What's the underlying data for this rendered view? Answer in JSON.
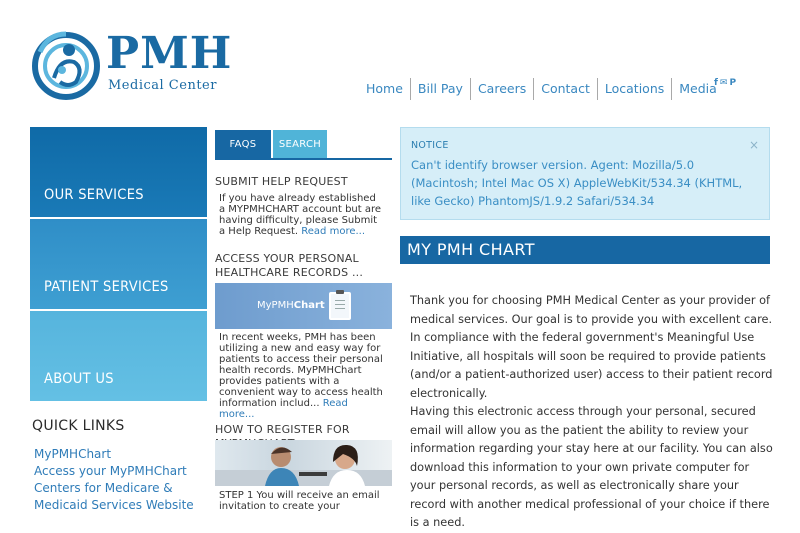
{
  "logo": {
    "name": "PMH",
    "subtitle": "Medical Center"
  },
  "nav": [
    "Home",
    "Bill Pay",
    "Careers",
    "Contact",
    "Locations",
    "Media"
  ],
  "social": {
    "facebook": "f",
    "email": "✉",
    "pinterest": "P"
  },
  "left_tiles": [
    "OUR SERVICES",
    "PATIENT SERVICES",
    "ABOUT US"
  ],
  "quick_links": {
    "title": "QUICK LINKS",
    "items": [
      "MyPMHChart",
      "Access your MyPMHChart",
      "Centers for Medicare &",
      "Medicaid Services Website"
    ]
  },
  "mid": {
    "tabs": [
      "FAQS",
      "SEARCH"
    ],
    "sections": [
      {
        "title": "SUBMIT HELP REQUEST",
        "body": "If you have already established a MYPMHCHART account but are having difficulty, please Submit a Help Request.",
        "more": "Read more..."
      },
      {
        "title": "ACCESS YOUR PERSONAL HEALTHCARE RECORDS ...",
        "body": "In recent weeks, PMH has been utilizing a new and easy way for patients to access their personal health records. MyPMHChart provides patients with a convenient way to access health information includ...",
        "more": "Read more..."
      },
      {
        "title": "HOW TO REGISTER FOR MYPMHCHART",
        "body": "STEP 1 You will receive an email invitation to create your",
        "more": ""
      }
    ],
    "banner": {
      "prefix": "MyPMH",
      "suffix": "Chart"
    }
  },
  "notice": {
    "title": "NOTICE",
    "close": "×",
    "message": "Can't identify browser version. Agent: Mozilla/5.0 (Macintosh; Intel Mac OS X) AppleWebKit/534.34 (KHTML, like Gecko) PhantomJS/1.9.2 Safari/534.34"
  },
  "main": {
    "heading": "MY PMH CHART",
    "paragraphs": [
      "Thank you for choosing PMH Medical Center as your provider of medical services.  Our goal is to provide you with excellent care. In compliance with the federal government's Meaningful Use Initiative, all hospitals will soon be required to provide patients (and/or a patient-authorized user) access to their patient record electronically.",
      "Having this electronic access through your personal, secured email will allow you as the patient the ability to review your information regarding your stay here at our facility.  You can also download this information to your own private computer for your personal records, as well as electronically share your record with another medical professional of your choice if there is a need."
    ]
  }
}
